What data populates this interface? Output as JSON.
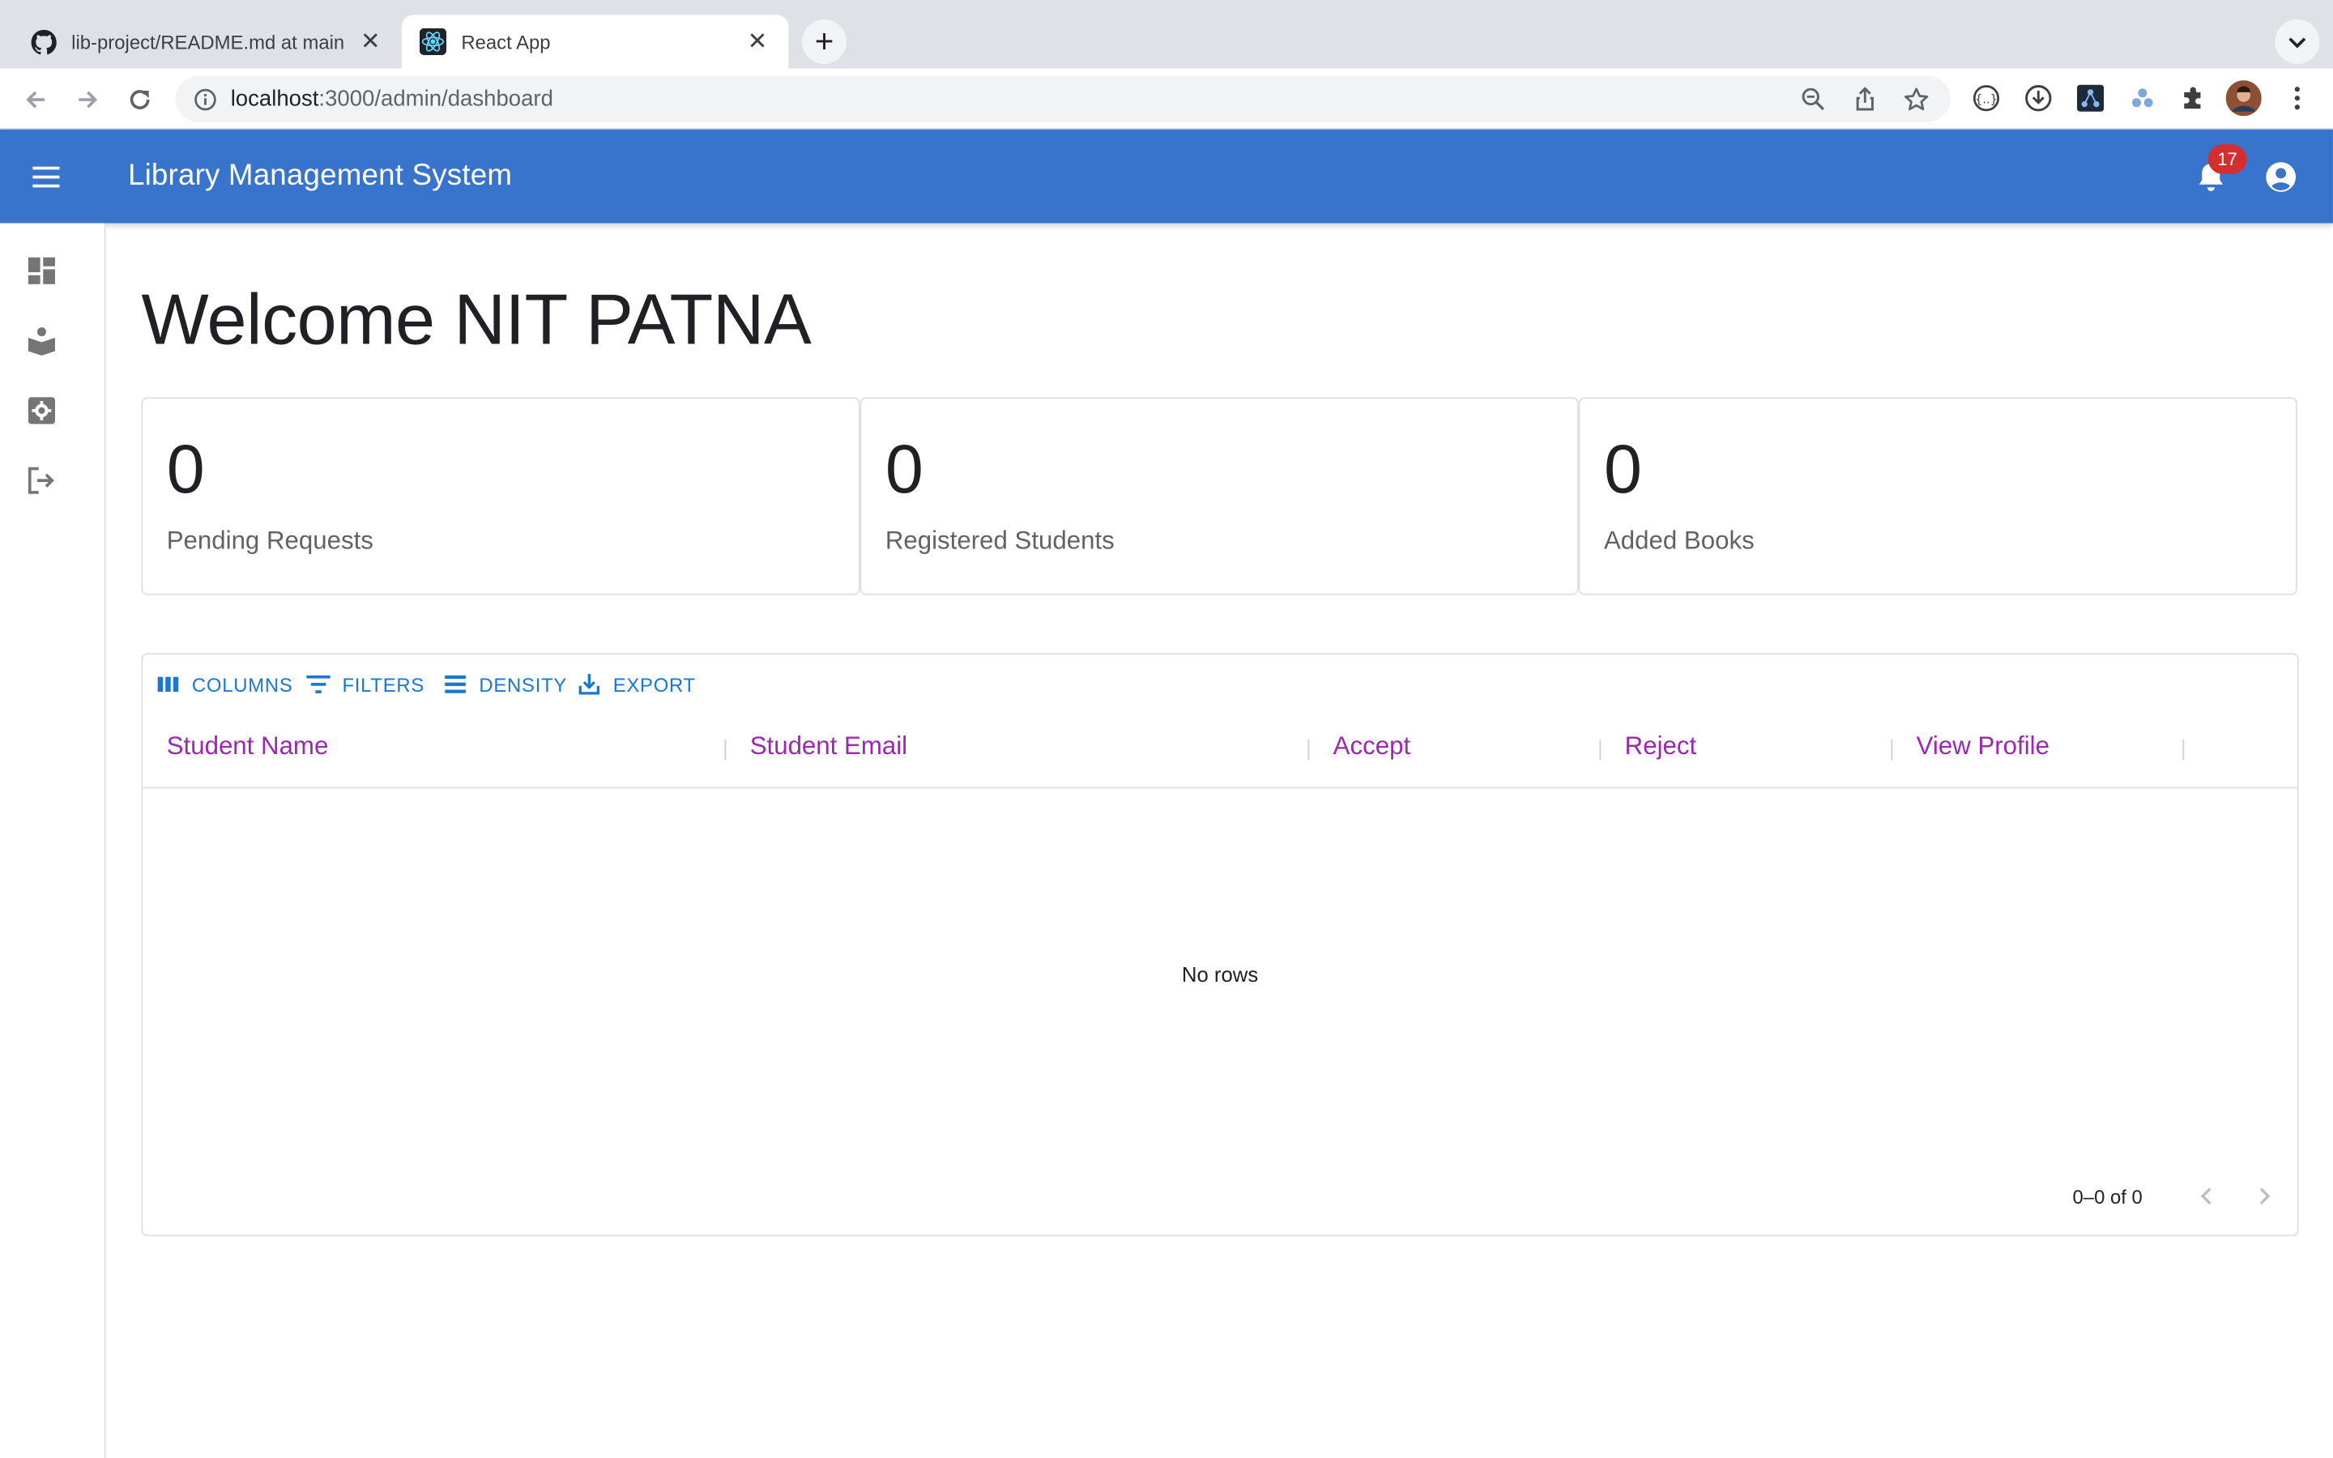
{
  "browser": {
    "tabs": [
      {
        "title": "lib-project/README.md at main",
        "icon": "github-icon",
        "active": false
      },
      {
        "title": "React App",
        "icon": "react-icon",
        "active": true
      }
    ],
    "url_host": "localhost",
    "url_path": ":3000/admin/dashboard"
  },
  "appbar": {
    "title": "Library Management System",
    "notification_count": "17",
    "color": "#3874cb"
  },
  "sidebar": {
    "items": [
      {
        "icon": "dashboard-icon"
      },
      {
        "icon": "book-reader-icon"
      },
      {
        "icon": "settings-box-icon"
      },
      {
        "icon": "logout-icon"
      }
    ]
  },
  "main": {
    "welcome": "Welcome NIT PATNA",
    "stats": [
      {
        "value": "0",
        "label": "Pending Requests"
      },
      {
        "value": "0",
        "label": "Registered Students"
      },
      {
        "value": "0",
        "label": "Added Books"
      }
    ]
  },
  "grid": {
    "toolbar": {
      "columns": "COLUMNS",
      "filters": "FILTERS",
      "density": "DENSITY",
      "export": "EXPORT"
    },
    "columns": [
      "Student Name",
      "Student Email",
      "Accept",
      "Reject",
      "View Profile"
    ],
    "empty_text": "No rows",
    "pagination": "0–0 of 0",
    "header_color": "#9c27b0",
    "accent": "#1976d2"
  }
}
